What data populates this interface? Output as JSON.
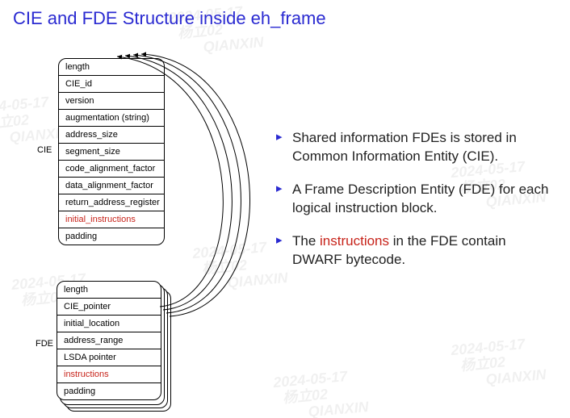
{
  "title": "CIE and FDE Structure inside eh_frame",
  "cie": {
    "label": "CIE",
    "fields": [
      {
        "name": "length",
        "highlight": false
      },
      {
        "name": "CIE_id",
        "highlight": false
      },
      {
        "name": "version",
        "highlight": false
      },
      {
        "name": "augmentation (string)",
        "highlight": false
      },
      {
        "name": "address_size",
        "highlight": false
      },
      {
        "name": "segment_size",
        "highlight": false
      },
      {
        "name": "code_alignment_factor",
        "highlight": false
      },
      {
        "name": "data_alignment_factor",
        "highlight": false
      },
      {
        "name": "return_address_register",
        "highlight": false
      },
      {
        "name": "initial_instructions",
        "highlight": true
      },
      {
        "name": "padding",
        "highlight": false
      }
    ]
  },
  "fde": {
    "label": "FDE",
    "fields": [
      {
        "name": "length",
        "highlight": false
      },
      {
        "name": "CIE_pointer",
        "highlight": false
      },
      {
        "name": "initial_location",
        "highlight": false
      },
      {
        "name": "address_range",
        "highlight": false
      },
      {
        "name": "LSDA pointer",
        "highlight": false
      },
      {
        "name": "instructions",
        "highlight": true
      },
      {
        "name": "padding",
        "highlight": false
      }
    ]
  },
  "bullets": [
    {
      "pre": "Shared information FDEs is stored in Common Information Entity (CIE).",
      "hl": "",
      "post": ""
    },
    {
      "pre": "A Frame Description Entity (FDE) for each logical instruction block.",
      "hl": "",
      "post": ""
    },
    {
      "pre": "The ",
      "hl": "instructions",
      "post": " in the FDE contain DWARF bytecode."
    }
  ],
  "watermark": {
    "date": "2024-05-17",
    "name": "杨立02",
    "org": "QIANXIN"
  }
}
